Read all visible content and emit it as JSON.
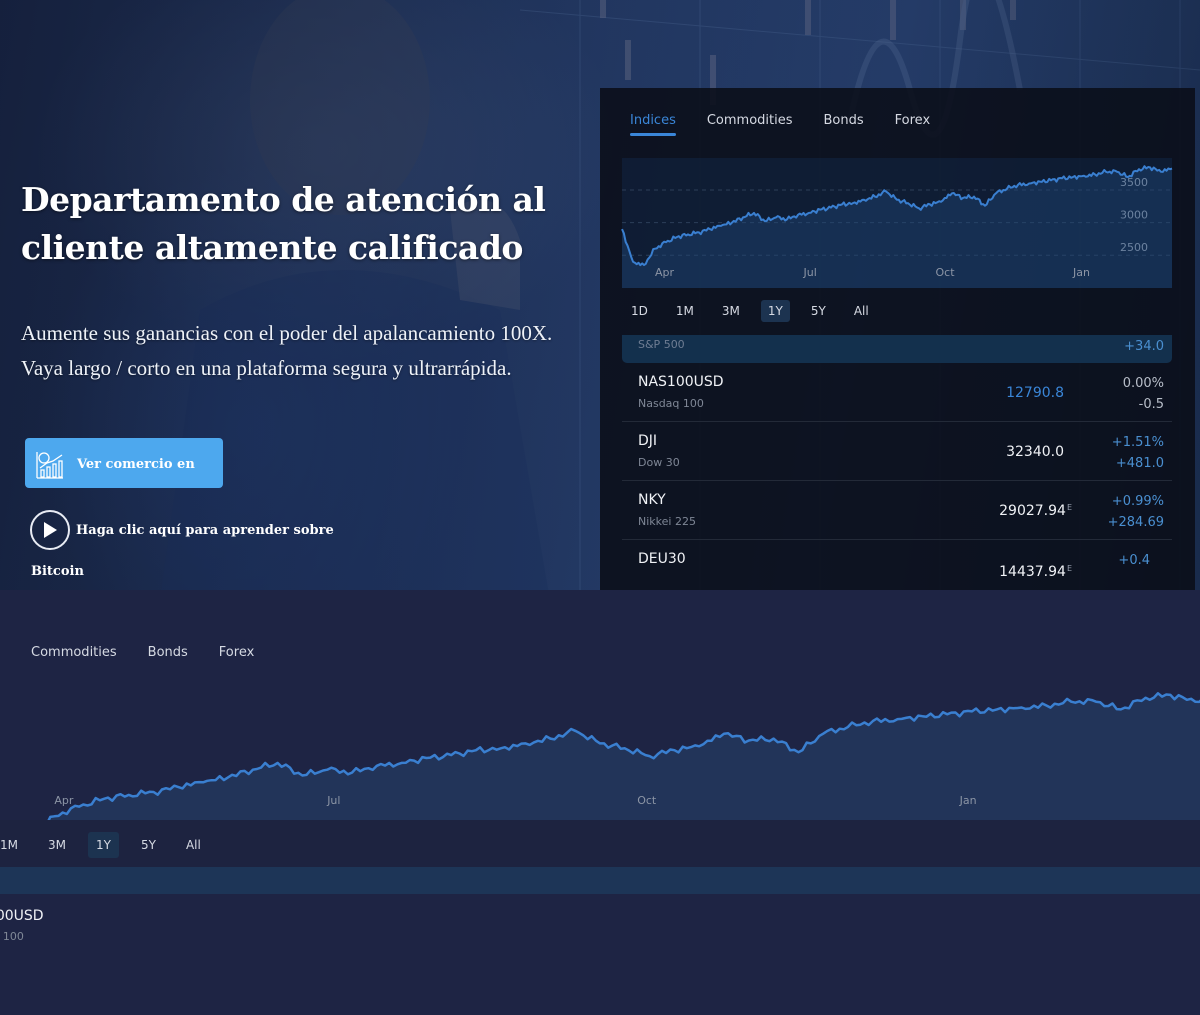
{
  "hero": {
    "title": "Departamento de atención al cliente altamente calificado",
    "subtitle": "Aumente sus ganancias con el poder del apalancamiento 100X. Vaya largo / corto en una plataforma segura y ultrarrápida.",
    "cta_label": "Ver comercio en vivo",
    "play_label": "Haga clic aquí para aprender sobre",
    "play_sublabel": "Bitcoin"
  },
  "widget": {
    "tabs": [
      {
        "label": "Indices",
        "active": true
      },
      {
        "label": "Commodities",
        "active": false
      },
      {
        "label": "Bonds",
        "active": false
      },
      {
        "label": "Forex",
        "active": false
      }
    ],
    "ranges": [
      {
        "label": "1D",
        "active": false
      },
      {
        "label": "1M",
        "active": false
      },
      {
        "label": "3M",
        "active": false
      },
      {
        "label": "1Y",
        "active": true
      },
      {
        "label": "5Y",
        "active": false
      },
      {
        "label": "All",
        "active": false
      }
    ],
    "rows": [
      {
        "symbol": "",
        "name": "S&P 500",
        "price": "",
        "suffix": "",
        "pct": "",
        "change": "+34.0",
        "highlight": true
      },
      {
        "symbol": "NAS100USD",
        "name": "Nasdaq 100",
        "price": "12790.8",
        "suffix": "",
        "pct": "0.00%",
        "change": "-0.5",
        "price_color": "blue",
        "change_color": "grey"
      },
      {
        "symbol": "DJI",
        "name": "Dow 30",
        "price": "32340.0",
        "suffix": "",
        "pct": "+1.51%",
        "change": "+481.0",
        "price_color": "white",
        "change_color": "blue"
      },
      {
        "symbol": "NKY",
        "name": "Nikkei 225",
        "price": "29027.94",
        "suffix": "E",
        "pct": "+0.99%",
        "change": "+284.69",
        "price_color": "white",
        "change_color": "blue"
      },
      {
        "symbol": "DEU30",
        "name": "",
        "price": "14437.94",
        "suffix": "E",
        "pct": "+0.4",
        "change": "",
        "price_color": "white",
        "change_color": "blue"
      }
    ],
    "colors": {
      "accent": "#3a86d8",
      "line": "#3a7fd0",
      "panel": "#0a0e18"
    }
  },
  "chart_data": {
    "type": "area",
    "title": "",
    "x_ticks": [
      "Apr",
      "Jul",
      "Oct",
      "Jan"
    ],
    "y_ticks": [
      2500,
      3000,
      3500
    ],
    "ylim": [
      2150,
      3900
    ],
    "grid": true,
    "x": [
      0,
      2,
      4,
      6,
      8,
      10,
      12,
      14,
      16,
      18,
      20,
      22,
      24,
      26,
      28,
      30,
      32,
      34,
      36,
      38,
      40,
      42,
      44,
      46,
      48,
      50,
      52,
      54,
      56,
      58,
      60,
      62,
      64,
      66,
      68,
      70,
      72,
      74,
      76,
      78,
      80,
      82,
      84,
      86,
      88,
      90,
      92,
      94,
      96,
      98,
      100
    ],
    "values": [
      2900,
      2400,
      2350,
      2600,
      2700,
      2780,
      2820,
      2850,
      2900,
      2950,
      3000,
      3080,
      3150,
      3020,
      3080,
      3050,
      3120,
      3150,
      3200,
      3230,
      3280,
      3300,
      3350,
      3400,
      3480,
      3350,
      3300,
      3220,
      3280,
      3320,
      3450,
      3380,
      3400,
      3260,
      3450,
      3520,
      3580,
      3600,
      3630,
      3650,
      3680,
      3700,
      3720,
      3740,
      3780,
      3780,
      3700,
      3820,
      3850,
      3780,
      3830
    ],
    "series_name": "S&P 500",
    "legend": "none"
  },
  "carousel": {
    "count": 3,
    "active": 0
  }
}
